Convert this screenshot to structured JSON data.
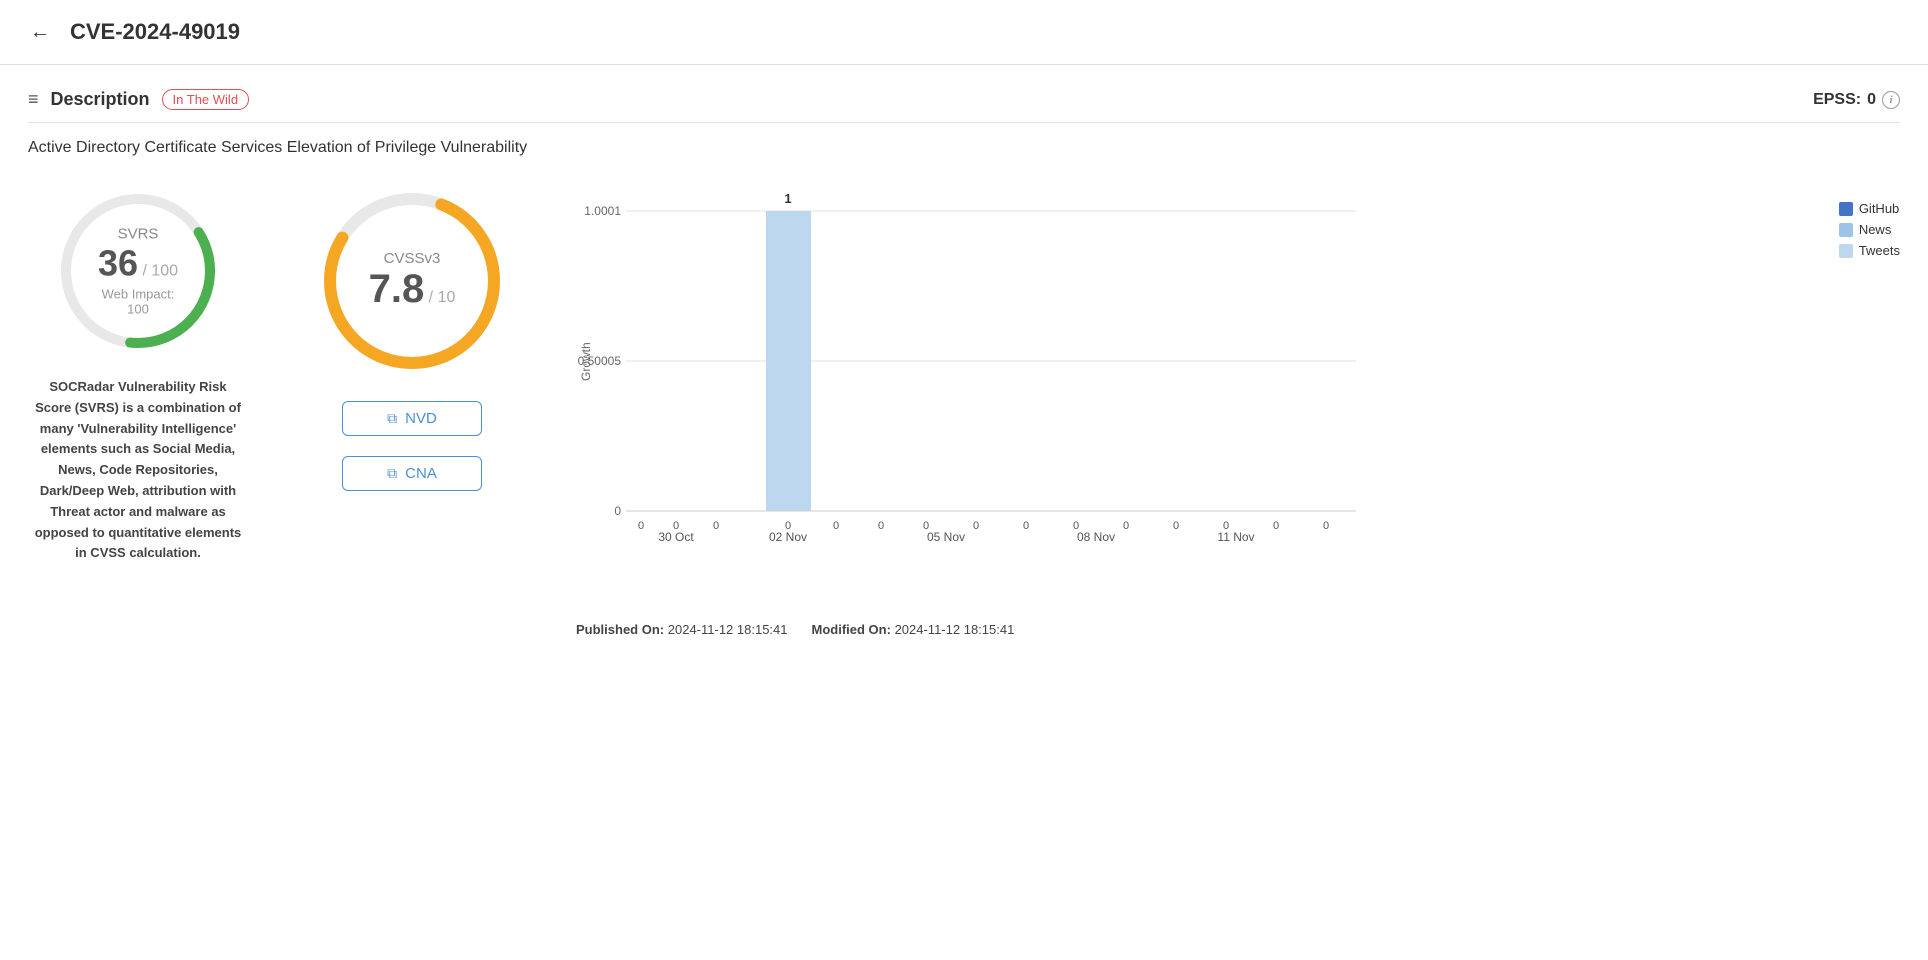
{
  "header": {
    "title": "CVE-2024-49019",
    "back_label": "←"
  },
  "section": {
    "icon": "≡",
    "title": "Description",
    "badge": "In The Wild",
    "epss_label": "EPSS:",
    "epss_value": "0"
  },
  "vuln_title": "Active Directory Certificate Services Elevation of Privilege Vulnerability",
  "svrs": {
    "label": "SVRS",
    "value": "36",
    "max": "100",
    "web_impact_label": "Web Impact:",
    "web_impact_value": "100",
    "description": "SOCRadar Vulnerability Risk Score (SVRS) is a combination of many 'Vulnerability Intelligence' elements such as Social Media, News, Code Repositories, Dark/Deep Web, attribution with Threat actor and malware as opposed to quantitative elements in CVSS calculation.",
    "color": "#4caf50"
  },
  "cvss": {
    "label": "CVSSv3",
    "value": "7.8",
    "max": "10",
    "color": "#f5a623"
  },
  "buttons": {
    "nvd": "NVD",
    "cna": "CNA"
  },
  "chart": {
    "y_labels": [
      "1.0001",
      "0.50005",
      "0"
    ],
    "x_labels": [
      "30 Oct",
      "02 Nov",
      "05 Nov",
      "08 Nov",
      "11 Nov"
    ],
    "bar_value_label": "1",
    "growth_label": "Growth",
    "legend": [
      {
        "label": "GitHub",
        "color": "#4472C4"
      },
      {
        "label": "News",
        "color": "#9DC3E6"
      },
      {
        "label": "Tweets",
        "color": "#BDD7EE"
      }
    ],
    "data_labels": [
      "0",
      "0",
      "0",
      "1",
      "0",
      "0",
      "0",
      "0",
      "0",
      "0",
      "0",
      "0",
      "0",
      "0",
      "0"
    ]
  },
  "published": {
    "label": "Published On:",
    "value": "2024-11-12 18:15:41",
    "modified_label": "Modified On:",
    "modified_value": "2024-11-12 18:15:41"
  }
}
